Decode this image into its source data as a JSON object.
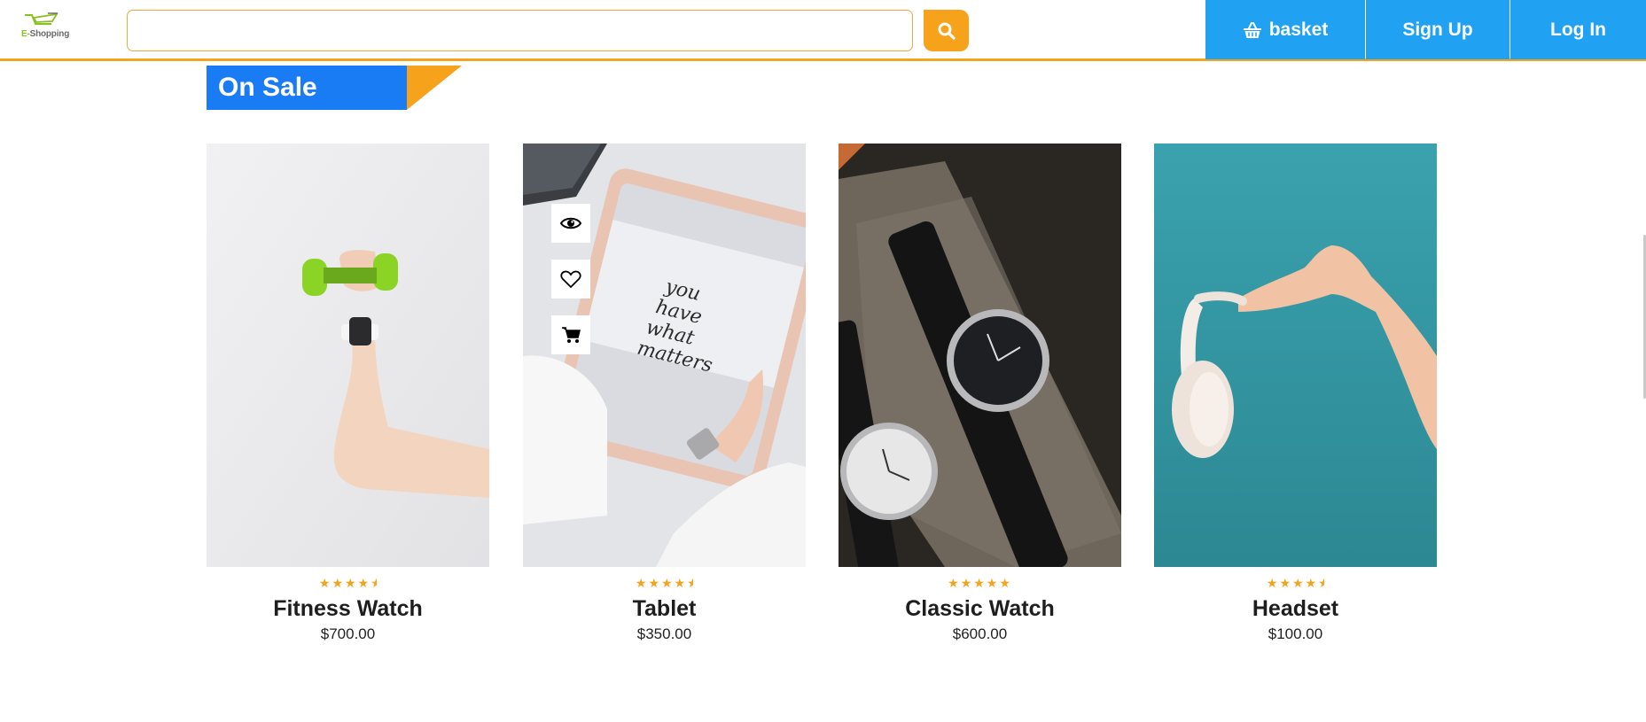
{
  "header": {
    "logo_text_green": "E-",
    "logo_text_dark": "Shopping",
    "search": {
      "value": "",
      "placeholder": ""
    },
    "nav": {
      "basket": "basket",
      "signup": "Sign Up",
      "login": "Log In"
    }
  },
  "section": {
    "title": "On Sale"
  },
  "colors": {
    "accent": "#f7a21b",
    "nav_blue": "#21a1f1",
    "title_blue": "#1a7cf4"
  },
  "products": [
    {
      "name": "Fitness Watch",
      "price": "$700.00",
      "rating": 4.5
    },
    {
      "name": "Tablet",
      "price": "$350.00",
      "rating": 4.5
    },
    {
      "name": "Classic Watch",
      "price": "$600.00",
      "rating": 5
    },
    {
      "name": "Headset",
      "price": "$100.00",
      "rating": 4.5
    }
  ],
  "card_actions": [
    "eye-icon",
    "heart-icon",
    "cart-icon"
  ]
}
